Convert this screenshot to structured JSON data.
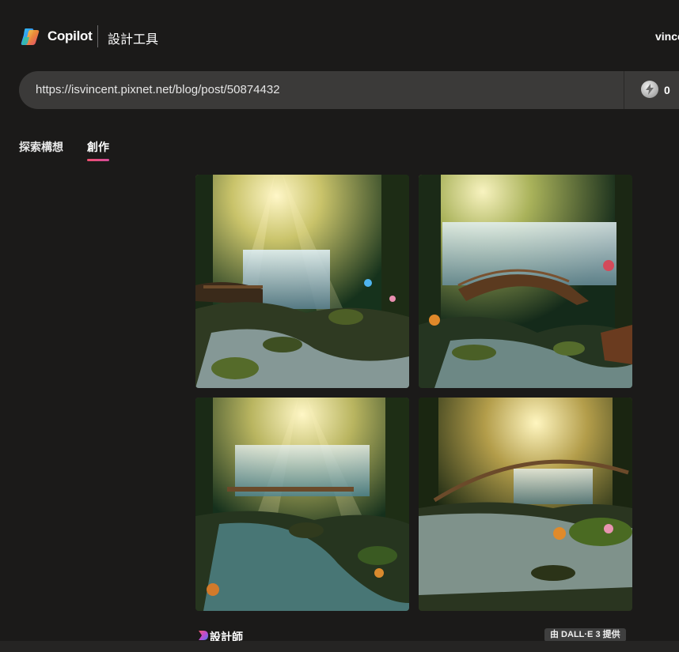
{
  "header": {
    "brand": "Copilot",
    "product": "設計工具",
    "user": "vince",
    "logo_icon": "copilot-logo-icon"
  },
  "prompt": {
    "text": "https://isvincent.pixnet.net/blog/post/50874432",
    "boost_icon": "boost-coin-icon",
    "boost_count": "0"
  },
  "tabs": [
    {
      "label": "探索構想",
      "active": false
    },
    {
      "label": "創作",
      "active": true
    }
  ],
  "results": {
    "images": [
      {
        "subject": "forest waterfall with wooden bridge and butterflies"
      },
      {
        "subject": "forest waterfall with wooden bridge and butterflies"
      },
      {
        "subject": "forest waterfall with wooden bridge and butterflies"
      },
      {
        "subject": "forest waterfall with wooden bridge and butterflies"
      }
    ],
    "designer_label": "設計師",
    "designer_icon": "designer-logo-icon",
    "provider_badge": "由 DALL·E 3 提供"
  },
  "colors": {
    "background": "#1b1a19",
    "prompt_bar": "#3b3a39",
    "accent_underline": "#e84f7d",
    "badge": "#3f3f3f"
  }
}
